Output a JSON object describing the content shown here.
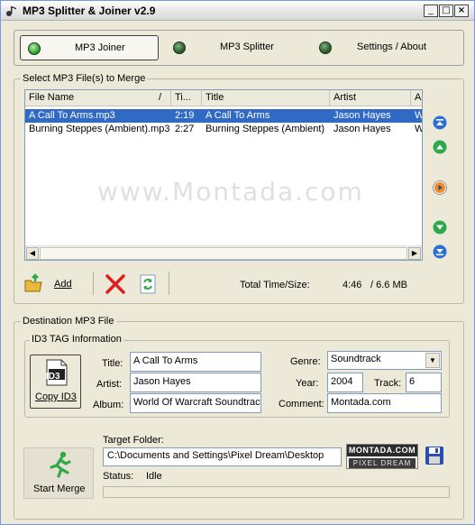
{
  "window": {
    "title": "MP3 Splitter & Joiner v2.9",
    "minimize_icon": "minimize-icon",
    "maximize_icon": "maximize-icon",
    "close_icon": "close-icon",
    "minimize_glyph": "_",
    "maximize_glyph": "□",
    "close_glyph": "×"
  },
  "tabs": [
    {
      "label": "MP3 Joiner",
      "active": true
    },
    {
      "label": "MP3 Splitter",
      "active": false
    },
    {
      "label": "Settings / About",
      "active": false
    }
  ],
  "select_group": {
    "label": "Select MP3 File(s) to Merge",
    "columns": [
      "File Name",
      "Ti...",
      "Title",
      "Artist",
      "A"
    ],
    "sort_glyph": "/",
    "rows": [
      {
        "file": "A Call To Arms.mp3",
        "time": "2:19",
        "title": "A Call To Arms",
        "artist": "Jason Hayes",
        "album": "W",
        "selected": true
      },
      {
        "file": "Burning Steppes (Ambient).mp3",
        "time": "2:27",
        "title": "Burning Steppes (Ambient)",
        "artist": "Jason Hayes",
        "album": "W",
        "selected": false
      }
    ],
    "watermark": "www.Montada.com",
    "side_buttons": [
      "move-top-icon",
      "move-up-icon",
      "play-icon",
      "move-down-icon",
      "move-bottom-icon"
    ]
  },
  "toolbar": {
    "add_label": "Add",
    "total_label": "Total Time/Size:",
    "total_time": "4:46",
    "total_size": "/ 6.6 MB"
  },
  "destination": {
    "group_label": "Destination MP3 File",
    "id3_group_label": "ID3 TAG Information",
    "copy_id3_label": "Copy ID3",
    "id3_badge": "ID3",
    "title_label": "Title:",
    "title_value": "A Call To Arms",
    "artist_label": "Artist:",
    "artist_value": "Jason Hayes",
    "album_label": "Album:",
    "album_value": "World Of Warcraft Soundtrac",
    "genre_label": "Genre:",
    "genre_value": "Soundtrack",
    "year_label": "Year:",
    "year_value": "2004",
    "track_label": "Track:",
    "track_value": "6",
    "comment_label": "Comment:",
    "comment_value": "Montada.com"
  },
  "footer": {
    "start_merge_label": "Start Merge",
    "target_folder_label": "Target Folder:",
    "target_folder_value": "C:\\Documents and Settings\\Pixel Dream\\Desktop",
    "status_label": "Status:",
    "status_value": "Idle",
    "logo_top": "MONTADA.COM",
    "logo_bottom": "PIXEL DREAM",
    "progress": 0
  }
}
